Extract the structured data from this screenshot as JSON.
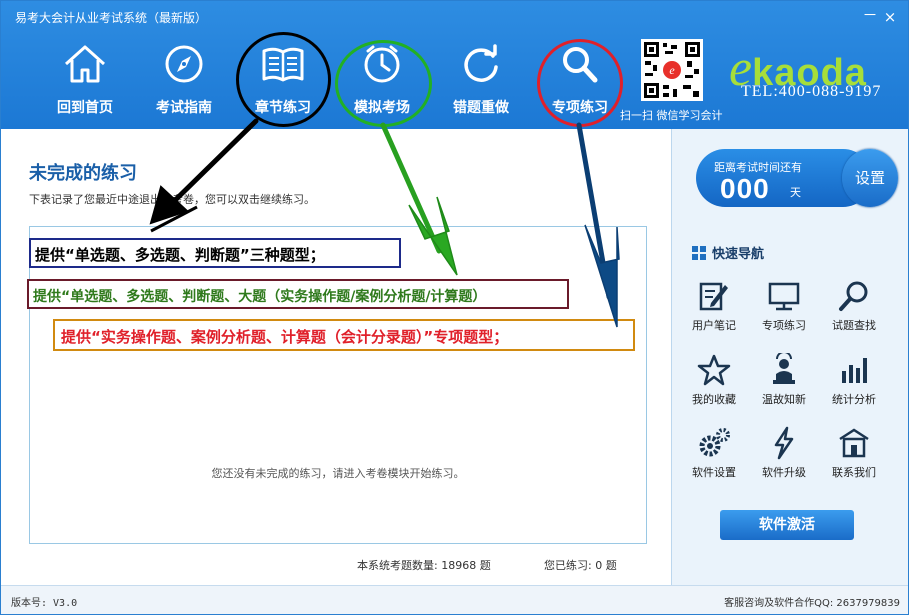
{
  "window": {
    "title": "易考大会计从业考试系统（最新版）",
    "minimize": "－",
    "close": "×"
  },
  "nav": [
    {
      "label": "回到首页",
      "icon": "home-icon"
    },
    {
      "label": "考试指南",
      "icon": "compass-icon"
    },
    {
      "label": "章节练习",
      "icon": "book-icon"
    },
    {
      "label": "模拟考场",
      "icon": "clock-icon"
    },
    {
      "label": "错题重做",
      "icon": "refresh-icon"
    },
    {
      "label": "专项练习",
      "icon": "search-icon"
    }
  ],
  "brand": {
    "e": "e",
    "name": "kaoda",
    "tel": "TEL:400-088-9197",
    "qr_caption": "扫一扫 微信学习会计"
  },
  "main": {
    "title": "未完成的练习",
    "description": "下表记录了您最近中途退出的考卷，您可以双击继续练习。",
    "empty_message": "您还没有未完成的练习，请进入考卷模块开始练习。",
    "total_questions": "本系统考题数量: 18968 题",
    "practiced": "您已练习: 0 题"
  },
  "annotations": {
    "note1": "提供“单选题、多选题、判断题”三种题型；",
    "note2": "提供“单选题、多选题、判断题、大题（实务操作题/案例分析题/计算题）",
    "note3": "提供“实务操作题、案例分析题、计算题（会计分录题）”专项题型；"
  },
  "sidebar": {
    "countdown_label": "距离考试时间还有",
    "countdown_days": "000",
    "countdown_unit": "天",
    "setting_label": "设置",
    "quicknav_title": "快速导航",
    "items": [
      {
        "label": "用户笔记",
        "icon": "note-icon"
      },
      {
        "label": "专项练习",
        "icon": "monitor-icon"
      },
      {
        "label": "试题查找",
        "icon": "magnifier-icon"
      },
      {
        "label": "我的收藏",
        "icon": "star-icon"
      },
      {
        "label": "温故知新",
        "icon": "reader-icon"
      },
      {
        "label": "统计分析",
        "icon": "bar-chart-icon"
      },
      {
        "label": "软件设置",
        "icon": "gears-icon"
      },
      {
        "label": "软件升级",
        "icon": "lightning-icon"
      },
      {
        "label": "联系我们",
        "icon": "building-icon"
      }
    ],
    "activate_label": "软件激活"
  },
  "footer": {
    "version": "版本号: V3.0",
    "service": "客服咨询及软件合作QQ: 2637979839"
  },
  "colors": {
    "header": "#1c78d4",
    "brand_green": "#a7de3a",
    "title_blue": "#1a5fa8"
  }
}
